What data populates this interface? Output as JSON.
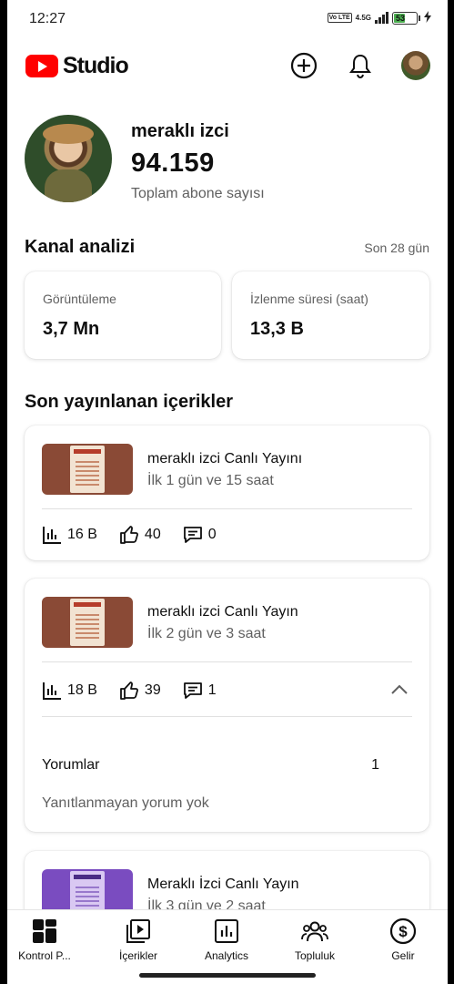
{
  "status_bar": {
    "time": "12:27",
    "volte": "Vo LTE",
    "network": "4.5G",
    "battery": "53"
  },
  "header": {
    "app_name": "Studio"
  },
  "channel": {
    "name": "meraklı izci",
    "subscribers": "94.159",
    "subscribers_label": "Toplam abone sayısı"
  },
  "analytics": {
    "title": "Kanal analizi",
    "period": "Son 28 gün",
    "stats": [
      {
        "label": "Görüntüleme",
        "value": "3,7 Mn"
      },
      {
        "label": "İzlenme süresi (saat)",
        "value": "13,3 B"
      }
    ]
  },
  "recent": {
    "title": "Son yayınlanan içerikler",
    "videos": [
      {
        "title": "meraklı izci Canlı Yayını",
        "subtitle": "İlk 1 gün ve 15 saat",
        "views": "16 B",
        "likes": "40",
        "comments": "0"
      },
      {
        "title": "meraklı izci Canlı Yayın",
        "subtitle": "İlk 2 gün ve 3 saat",
        "views": "18 B",
        "likes": "39",
        "comments": "1",
        "comments_section": {
          "label": "Yorumlar",
          "count": "1",
          "empty": "Yanıtlanmayan yorum yok"
        }
      },
      {
        "title": "Meraklı İzci Canlı Yayın",
        "subtitle": "İlk 3 gün ve 2 saat"
      }
    ]
  },
  "bottom_nav": [
    {
      "label": "Kontrol P...",
      "icon": "dashboard-icon"
    },
    {
      "label": "İçerikler",
      "icon": "content-icon"
    },
    {
      "label": "Analytics",
      "icon": "analytics-icon"
    },
    {
      "label": "Topluluk",
      "icon": "community-icon"
    },
    {
      "label": "Gelir",
      "icon": "earn-icon"
    }
  ]
}
